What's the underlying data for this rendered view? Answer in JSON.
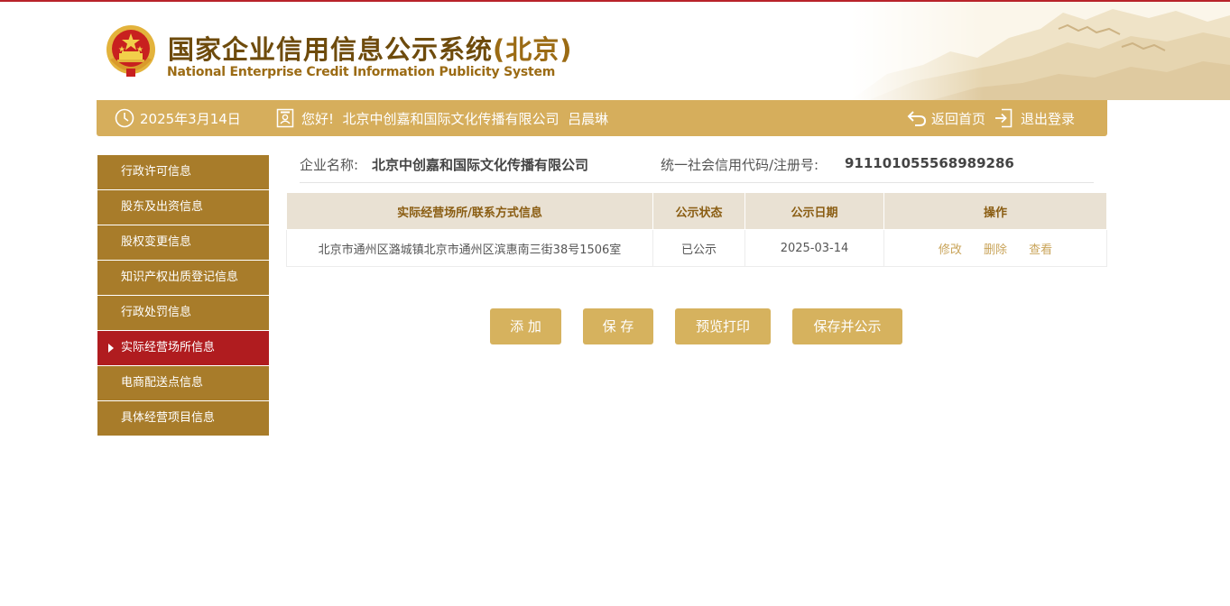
{
  "header": {
    "title_cn": "国家企业信用信息公示系统",
    "title_region": "(北京)",
    "title_en": "National Enterprise Credit Information Publicity System"
  },
  "infobar": {
    "date": "2025年3月14日",
    "greeting": "您好!  北京中创嘉和国际文化传播有限公司  吕晨琳",
    "home_link": "返回首页",
    "logout_link": "退出登录"
  },
  "sidebar": {
    "items": [
      {
        "label": "行政许可信息",
        "active": false
      },
      {
        "label": "股东及出资信息",
        "active": false
      },
      {
        "label": "股权变更信息",
        "active": false
      },
      {
        "label": "知识产权出质登记信息",
        "active": false
      },
      {
        "label": "行政处罚信息",
        "active": false
      },
      {
        "label": "实际经营场所信息",
        "active": true
      },
      {
        "label": "电商配送点信息",
        "active": false
      },
      {
        "label": "具体经营项目信息",
        "active": false
      }
    ]
  },
  "company": {
    "name_label": "企业名称:",
    "name_value": "北京中创嘉和国际文化传播有限公司",
    "code_label": "统一社会信用代码/注册号:",
    "code_value": "911101055568989286"
  },
  "table": {
    "headers": [
      "实际经营场所/联系方式信息",
      "公示状态",
      "公示日期",
      "操作"
    ],
    "rows": [
      {
        "address": "北京市通州区潞城镇北京市通州区滨惠南三街38号1506室",
        "status": "已公示",
        "date": "2025-03-14",
        "actions": [
          "修改",
          "删除",
          "查看"
        ]
      }
    ]
  },
  "buttons": {
    "add": "添 加",
    "save": "保 存",
    "preview_print": "预览打印",
    "save_publish": "保存并公示"
  },
  "colors": {
    "brand_gold": "#d6ae5c",
    "sidebar_brown": "#a87c2a",
    "active_red": "#b01c1f",
    "top_line_red": "#b8232a"
  },
  "icons": {
    "date": "clock-icon",
    "greeting": "id-card-icon",
    "home": "return-arrow-icon",
    "logout": "logout-icon",
    "logo": "national-emblem-icon"
  }
}
